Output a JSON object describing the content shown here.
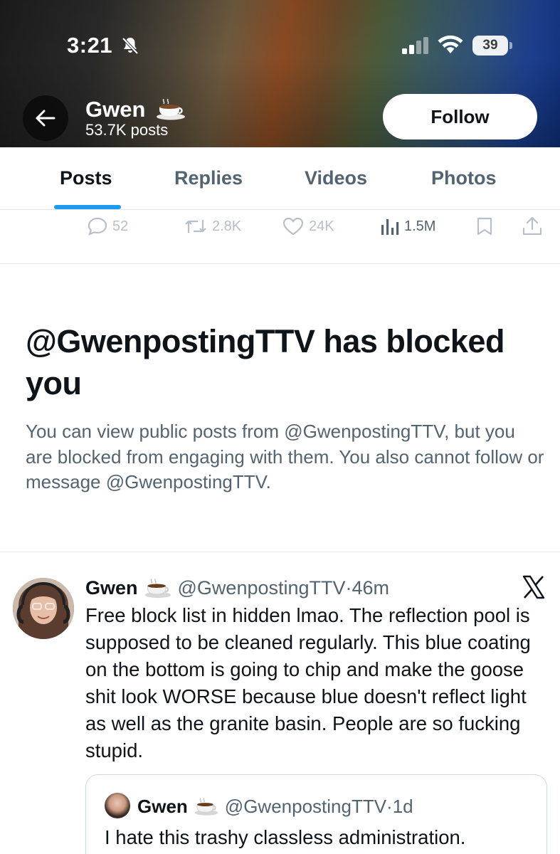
{
  "status_bar": {
    "time": "3:21",
    "battery": "39"
  },
  "profile_header": {
    "name": "Gwen",
    "posts_count": "53.7K posts",
    "follow_label": "Follow"
  },
  "tabs": [
    {
      "label": "Posts",
      "active": true
    },
    {
      "label": "Replies",
      "active": false
    },
    {
      "label": "Videos",
      "active": false
    },
    {
      "label": "Photos",
      "active": false
    }
  ],
  "actions": {
    "replies": "52",
    "reposts": "2.8K",
    "likes": "24K",
    "views": "1.5M"
  },
  "blocked_notice": {
    "title": "@GwenpostingTTV has blocked you",
    "body": "You can view public posts from @GwenpostingTTV, but you are blocked from engaging with them. You also cannot follow or message @GwenpostingTTV."
  },
  "tweet": {
    "name": "Gwen",
    "handle_time": "@GwenpostingTTV·46m",
    "text": "Free block list in hidden lmao. The reflection pool is supposed to be cleaned regularly. This blue coating on the bottom is going to chip and make the goose shit look WORSE because blue doesn't reflect light as well as the granite basin. People are so fucking stupid.",
    "quote": {
      "name": "Gwen",
      "handle_time": "@GwenpostingTTV·1d",
      "text": "I hate this trashy classless administration."
    }
  },
  "colors": {
    "accent": "#1d9bf0",
    "text_primary": "#0f1419",
    "text_secondary": "#536471",
    "border": "#e6e9ec"
  },
  "icons": [
    "bell-slash-icon",
    "signal-icon",
    "wifi-icon",
    "battery-icon",
    "back-arrow-icon",
    "coffee-icon",
    "reply-icon",
    "repost-icon",
    "like-icon",
    "views-icon",
    "bookmark-icon",
    "share-icon",
    "x-logo-icon"
  ]
}
